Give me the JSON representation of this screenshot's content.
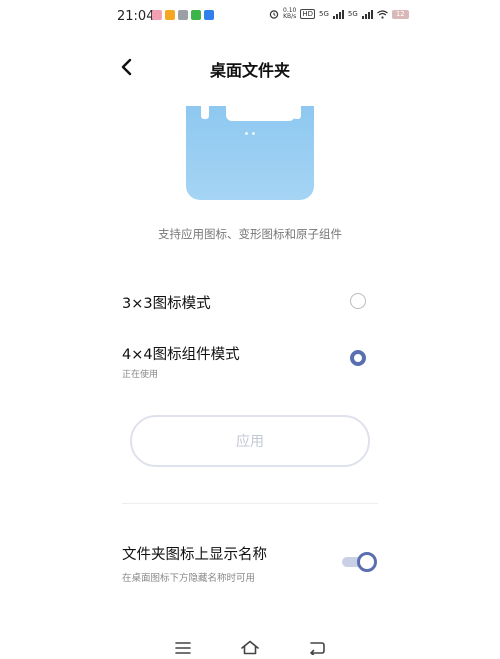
{
  "status_bar": {
    "time": "21:04",
    "notification_icons": [
      "#f2a0b2",
      "#f5a623",
      "#9aa0a6",
      "#3bb54a",
      "#2f80ed"
    ],
    "net_speed_value": "0.10",
    "net_speed_unit": "KB/s",
    "hd_badge": "HD",
    "sim1_label": "5G",
    "sim2_label": "5G",
    "battery": "12"
  },
  "header": {
    "title": "桌面文件夹"
  },
  "preview": {
    "caption": "支持应用图标、变形图标和原子组件"
  },
  "options": [
    {
      "label": "3×3图标模式",
      "sublabel": "",
      "selected": false
    },
    {
      "label": "4×4图标组件模式",
      "sublabel": "正在使用",
      "selected": true
    }
  ],
  "apply_button": {
    "label": "应用",
    "enabled": false
  },
  "folder_name_setting": {
    "label": "文件夹图标上显示名称",
    "description": "在桌面图标下方隐藏名称时可用",
    "enabled": true
  },
  "colors": {
    "accent": "#5a6fb0",
    "preview_blue": "#8ec8f0"
  }
}
